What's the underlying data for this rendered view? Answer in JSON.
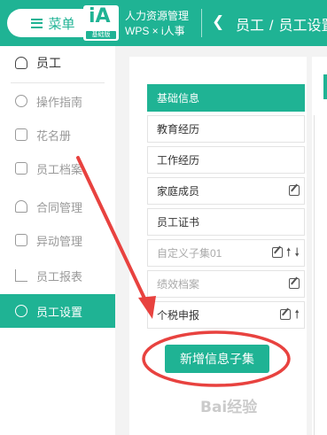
{
  "header": {
    "menu_label": "菜单",
    "logo_text": "iA",
    "logo_tag": "基础版",
    "app_name_line1": "人力资源管理",
    "app_name_line2": "WPS × i人事",
    "breadcrumb": [
      "员工",
      "员工设置"
    ],
    "breadcrumb_separator": "/",
    "back_icon": "chevron-left-icon"
  },
  "sidebar": {
    "items": [
      {
        "label": "员工",
        "icon": "person-icon"
      },
      {
        "label": "操作指南",
        "icon": "help-circle-icon"
      },
      {
        "label": "花名册",
        "icon": "roster-icon"
      },
      {
        "label": "员工档案",
        "icon": "file-icon"
      },
      {
        "label": "合同管理",
        "icon": "stamp-icon"
      },
      {
        "label": "异动管理",
        "icon": "transfer-icon"
      },
      {
        "label": "员工报表",
        "icon": "bar-chart-icon"
      },
      {
        "label": "员工设置",
        "icon": "gear-icon",
        "active": true
      }
    ]
  },
  "info_sets": {
    "title": "基础信息",
    "rows": [
      {
        "label": "教育经历",
        "edit": false,
        "up": false,
        "down": false,
        "muted": false
      },
      {
        "label": "工作经历",
        "edit": false,
        "up": false,
        "down": false,
        "muted": false
      },
      {
        "label": "家庭成员",
        "edit": true,
        "up": false,
        "down": false,
        "muted": false
      },
      {
        "label": "员工证书",
        "edit": false,
        "up": false,
        "down": false,
        "muted": false
      },
      {
        "label": "自定义子集01",
        "edit": true,
        "up": true,
        "down": true,
        "muted": true
      },
      {
        "label": "绩效档案",
        "edit": true,
        "up": false,
        "down": false,
        "muted": true
      },
      {
        "label": "个税申报",
        "edit": true,
        "up": true,
        "down": false,
        "muted": false
      }
    ],
    "add_button_label": "新增信息子集"
  },
  "watermark": "Bai经验",
  "colors": {
    "accent": "#1fb394",
    "annotation": "#e8423f"
  }
}
